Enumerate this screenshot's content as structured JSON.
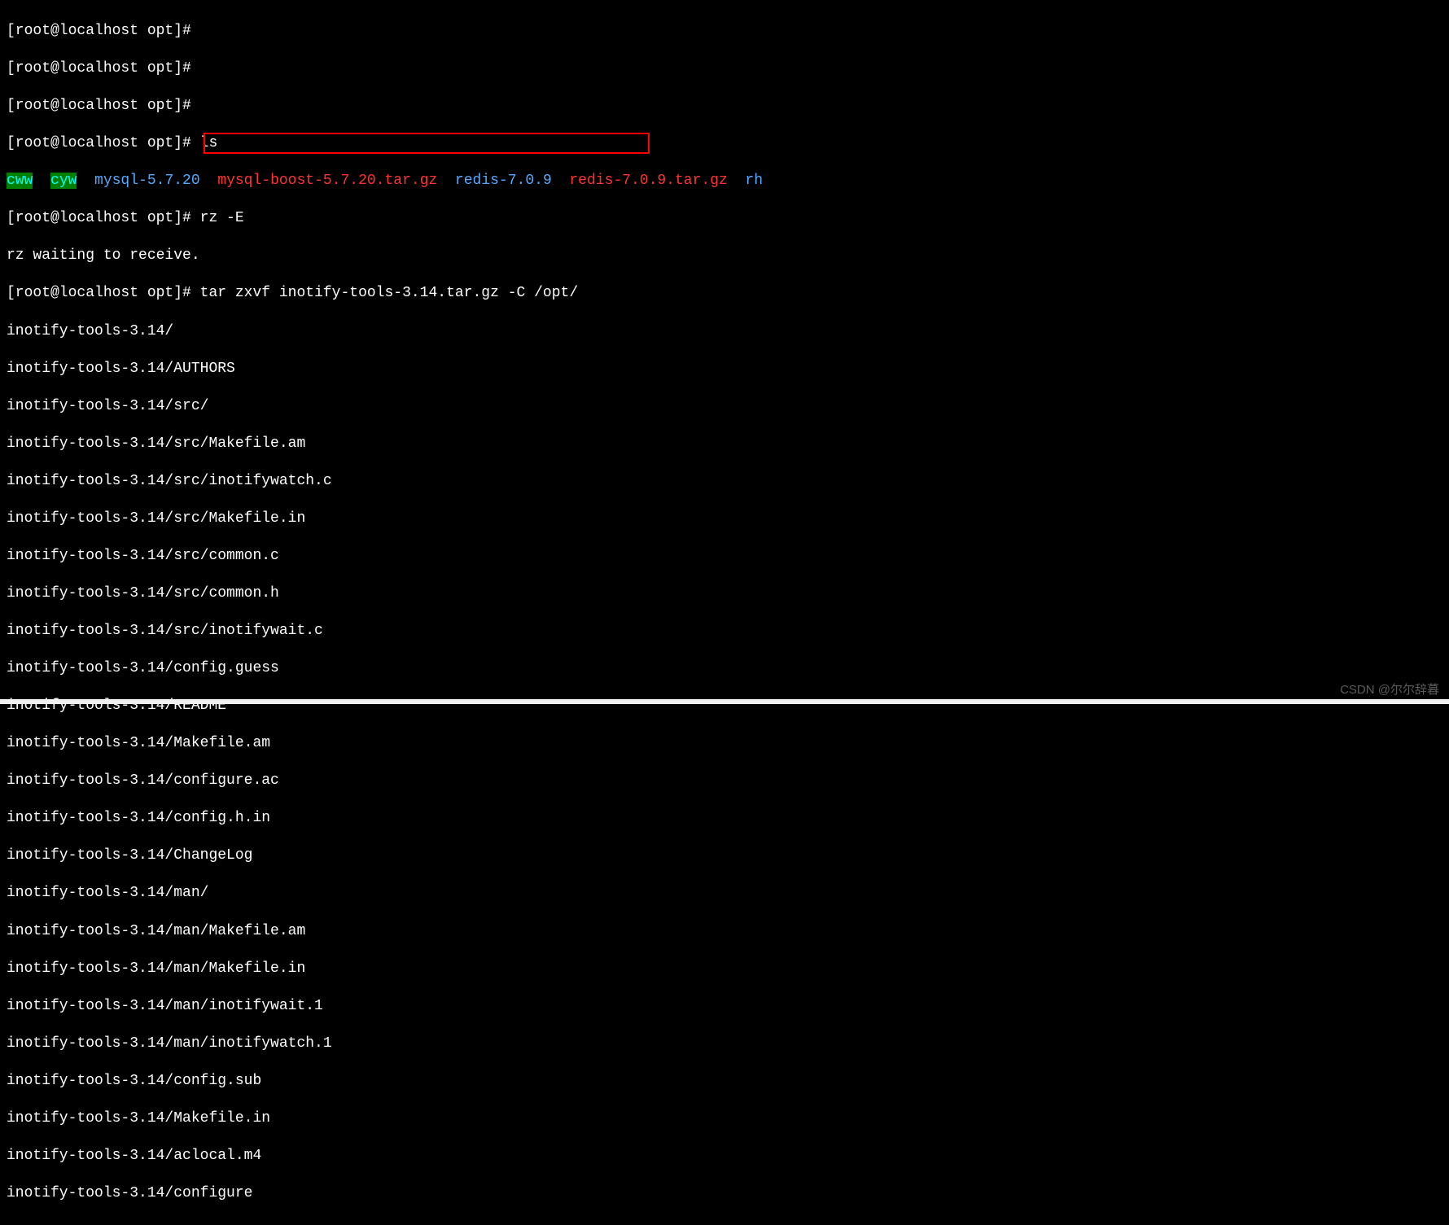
{
  "prompts": {
    "p1": "[root@localhost opt]# ",
    "p2": "[root@localhost opt]# ",
    "p3": "[root@localhost opt]# ",
    "p4": "[root@localhost opt]# ",
    "p5": "[root@localhost opt]# ",
    "p6": "[root@localhost opt]# "
  },
  "commands": {
    "ls": "ls",
    "rz": "rz -E",
    "tar": "tar zxvf inotify-tools-3.14.tar.gz -C /opt/"
  },
  "ls_output": {
    "cww": "cww",
    "cyw": "cyw",
    "mysql": "mysql-5.7.20",
    "mysqlboost": "mysql-boost-5.7.20.tar.gz",
    "redisdir": "redis-7.0.9",
    "redistar": "redis-7.0.9.tar.gz",
    "rh": "rh"
  },
  "rz_msg": "rz waiting to receive.",
  "tar_output": {
    "l1": "inotify-tools-3.14/",
    "l2": "inotify-tools-3.14/AUTHORS",
    "l3": "inotify-tools-3.14/src/",
    "l4": "inotify-tools-3.14/src/Makefile.am",
    "l5": "inotify-tools-3.14/src/inotifywatch.c",
    "l6": "inotify-tools-3.14/src/Makefile.in",
    "l7": "inotify-tools-3.14/src/common.c",
    "l8": "inotify-tools-3.14/src/common.h",
    "l9": "inotify-tools-3.14/src/inotifywait.c",
    "l10": "inotify-tools-3.14/config.guess",
    "l11": "inotify-tools-3.14/README",
    "l12": "inotify-tools-3.14/Makefile.am",
    "l13": "inotify-tools-3.14/configure.ac",
    "l14": "inotify-tools-3.14/config.h.in",
    "l15": "inotify-tools-3.14/ChangeLog",
    "l16": "inotify-tools-3.14/man/",
    "l17": "inotify-tools-3.14/man/Makefile.am",
    "l18": "inotify-tools-3.14/man/Makefile.in",
    "l19": "inotify-tools-3.14/man/inotifywait.1",
    "l20": "inotify-tools-3.14/man/inotifywatch.1",
    "l21": "inotify-tools-3.14/config.sub",
    "l22": "inotify-tools-3.14/Makefile.in",
    "l23": "inotify-tools-3.14/aclocal.m4",
    "l24": "inotify-tools-3.14/configure"
  },
  "watermark": "CSDN @尔尔辞暮"
}
